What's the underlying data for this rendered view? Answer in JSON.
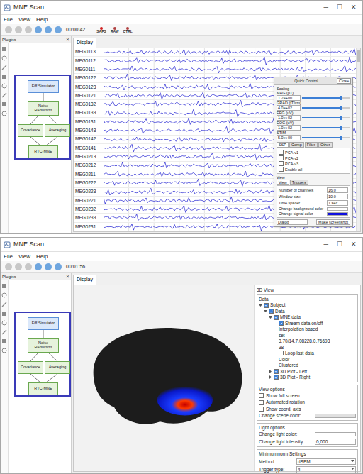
{
  "windows": [
    {
      "title": "MNE Scan",
      "controls": [
        "─",
        "☐",
        "✕"
      ],
      "menu": [
        "File",
        "View",
        "Help"
      ],
      "toolbar": {
        "time": "00:00:42",
        "labels": [
          "SAPS",
          "RAW",
          "CTRL"
        ]
      },
      "plugins": {
        "title": "Plugins",
        "close": "✕",
        "nodes": [
          {
            "label": "Fiff Simulator",
            "kind": "sensor",
            "color": "#5a8fd8"
          },
          {
            "label": "Noise Reduction",
            "kind": "algorithm",
            "color": "#6aa84f"
          },
          {
            "label": "Covariance",
            "kind": "algorithm",
            "color": "#6aa84f"
          },
          {
            "label": "Averaging",
            "kind": "algorithm",
            "color": "#6aa84f"
          },
          {
            "label": "RTC-MNE",
            "kind": "algorithm",
            "color": "#6aa84f"
          }
        ]
      },
      "display_tab": "Display",
      "view": {
        "kind": "raw",
        "channels": [
          "MEG0113",
          "MEG0112",
          "MEG0111",
          "MEG0122",
          "MEG0123",
          "MEG0121",
          "MEG0132",
          "MEG0133",
          "MEG0131",
          "MEG0143",
          "MEG0142",
          "MEG0141",
          "MEG0213",
          "MEG0212",
          "MEG0211",
          "MEG0222",
          "MEG0223",
          "MEG0221",
          "MEG0232",
          "MEG0233",
          "MEG0231"
        ],
        "quick_control": {
          "title": "Quick Control",
          "close": "Close",
          "scaling_title": "Scaling",
          "scales": [
            {
              "label": "MAG (pT)",
              "value": "1.2e+00",
              "level": 0.8
            },
            {
              "label": "GRAD (fT/cm)",
              "value": "4.0e+02",
              "level": 0.8
            },
            {
              "label": "EEG (uV)",
              "value": "1.0e+02",
              "level": 0.8
            },
            {
              "label": "EOG (uV)",
              "value": "1.0e+02",
              "level": 0.8
            },
            {
              "label": "STIM",
              "value": "5.0e+00",
              "level": 0.8
            }
          ],
          "tabs": [
            {
              "label": "SSP",
              "selected": true
            },
            {
              "label": "Comp",
              "selected": false
            },
            {
              "label": "Filter",
              "selected": false
            },
            {
              "label": "Other",
              "selected": false
            }
          ],
          "checks": [
            {
              "label": "PCA-v1",
              "checked": false
            },
            {
              "label": "PCA-v2",
              "checked": false
            },
            {
              "label": "PCA-v3",
              "checked": false
            },
            {
              "label": "Enable all",
              "checked": false
            }
          ],
          "view_title": "View",
          "view_tabs": [
            {
              "label": "View",
              "selected": true
            },
            {
              "label": "Triggers",
              "selected": false
            }
          ],
          "settings": [
            {
              "label": "Number of channels",
              "value": "16.0"
            },
            {
              "label": "Window size",
              "value": "10.0"
            },
            {
              "label": "Time spacer",
              "value": "1 sec"
            }
          ],
          "color_rows": [
            {
              "label": "Change background color",
              "color": "#ffffff"
            },
            {
              "label": "Change signal color",
              "color": "#1010e0"
            }
          ],
          "dropdown": "Dialog",
          "screenshot": "Make screenshot"
        }
      }
    },
    {
      "title": "MNE Scan",
      "controls": [
        "─",
        "☐",
        "✕"
      ],
      "menu": [
        "File",
        "View",
        "Help"
      ],
      "toolbar": {
        "time": "00:01:56",
        "labels": []
      },
      "plugins": {
        "title": "Plugins",
        "close": "✕",
        "nodes": [
          {
            "label": "Fiff Simulator",
            "kind": "sensor",
            "color": "#5a8fd8"
          },
          {
            "label": "Noise Reduction",
            "kind": "algorithm",
            "color": "#6aa84f"
          },
          {
            "label": "Covariance",
            "kind": "algorithm",
            "color": "#6aa84f"
          },
          {
            "label": "Averaging",
            "kind": "algorithm",
            "color": "#6aa84f"
          },
          {
            "label": "RTC-MNE",
            "kind": "algorithm",
            "color": "#6aa84f"
          }
        ]
      },
      "display_tab": "Display",
      "view": {
        "kind": "3d",
        "panel_title": "3D View",
        "tree_title": "Data",
        "tree": [
          {
            "label": "Subject",
            "depth": 0,
            "checkbox": true,
            "checked": true,
            "expander": true,
            "expanded": true
          },
          {
            "label": "Data",
            "depth": 1,
            "checkbox": true,
            "checked": true,
            "expander": true,
            "expanded": true
          },
          {
            "label": "MNE data",
            "depth": 2,
            "checkbox": true,
            "checked": true,
            "expander": true,
            "expanded": true
          },
          {
            "label": "Stream data on/off",
            "depth": 3,
            "checkbox": true,
            "checked": true,
            "expander": false,
            "expanded": false
          },
          {
            "label": "Interpolation based",
            "depth": 3,
            "checkbox": false,
            "checked": false,
            "expander": false,
            "expanded": false
          },
          {
            "label": "set",
            "depth": 3,
            "checkbox": false,
            "checked": false,
            "expander": false,
            "expanded": false
          },
          {
            "label": "3.70/14.7.08228,0.76693",
            "depth": 3,
            "checkbox": false,
            "checked": false,
            "expander": false,
            "expanded": false
          },
          {
            "label": "38",
            "depth": 3,
            "checkbox": false,
            "checked": false,
            "expander": false,
            "expanded": false
          },
          {
            "label": "Loop last data",
            "depth": 3,
            "checkbox": true,
            "checked": false,
            "expander": false,
            "expanded": false
          },
          {
            "label": "Color",
            "depth": 3,
            "checkbox": false,
            "checked": false,
            "expander": false,
            "expanded": false
          },
          {
            "label": "Clustered",
            "depth": 3,
            "checkbox": false,
            "checked": false,
            "expander": false,
            "expanded": false
          },
          {
            "label": "3D Plot - Left",
            "depth": 2,
            "checkbox": true,
            "checked": true,
            "expander": true,
            "expanded": false
          },
          {
            "label": "3D Plot - Right",
            "depth": 2,
            "checkbox": true,
            "checked": true,
            "expander": true,
            "expanded": false
          }
        ],
        "view_options_title": "View options",
        "view_options": [
          {
            "label": "Show full screen",
            "checked": false
          },
          {
            "label": "Automated rotation",
            "checked": false
          },
          {
            "label": "Show coord. axis",
            "checked": false
          }
        ],
        "scene_color_label": "Change scene color:",
        "light_title": "Light options",
        "light_color_label": "Change light color:",
        "light_intensity_label": "Change light intensity:",
        "light_intensity": "0,000",
        "mn_title": "Minimumnorm Settings",
        "mn_rows": [
          {
            "label": "Method:",
            "value": "dSPM"
          },
          {
            "label": "Trigger type:",
            "value": "4"
          }
        ]
      }
    }
  ]
}
